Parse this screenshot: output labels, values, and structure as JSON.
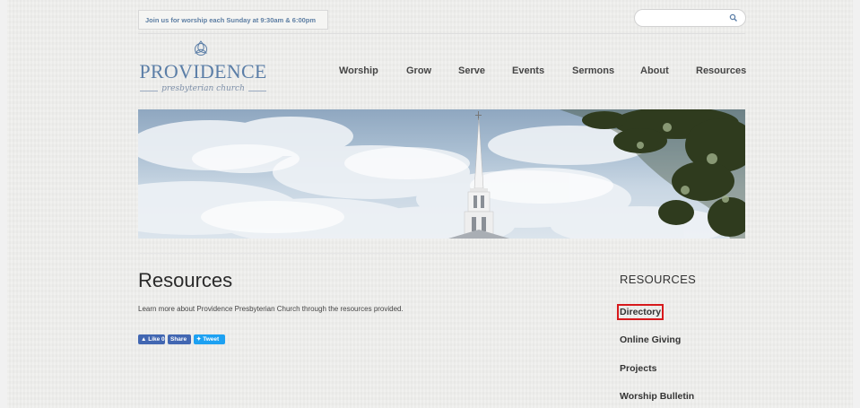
{
  "header": {
    "announcement": "Join us for worship each Sunday at 9:30am & 6:00pm",
    "search": {
      "placeholder": "",
      "value": ""
    }
  },
  "logo": {
    "name": "PROVIDENCE",
    "subtitle": "presbyterian church"
  },
  "nav": {
    "items": [
      {
        "label": "Worship"
      },
      {
        "label": "Grow"
      },
      {
        "label": "Serve"
      },
      {
        "label": "Events"
      },
      {
        "label": "Sermons"
      },
      {
        "label": "About"
      },
      {
        "label": "Resources"
      }
    ]
  },
  "main": {
    "title": "Resources",
    "intro": "Learn more about Providence Presbyterian Church through the resources provided."
  },
  "social": {
    "like_label": "Like 0",
    "share_label": "Share",
    "tweet_label": "Tweet"
  },
  "sidebar": {
    "title": "RESOURCES",
    "links": [
      {
        "label": "Directory",
        "highlighted": true
      },
      {
        "label": "Online Giving"
      },
      {
        "label": "Projects"
      },
      {
        "label": "Worship Bulletin"
      }
    ]
  },
  "colors": {
    "brand_blue": "#5b7ea7",
    "facebook": "#4267b2",
    "twitter": "#1da1f2",
    "highlight": "#d7191c"
  }
}
